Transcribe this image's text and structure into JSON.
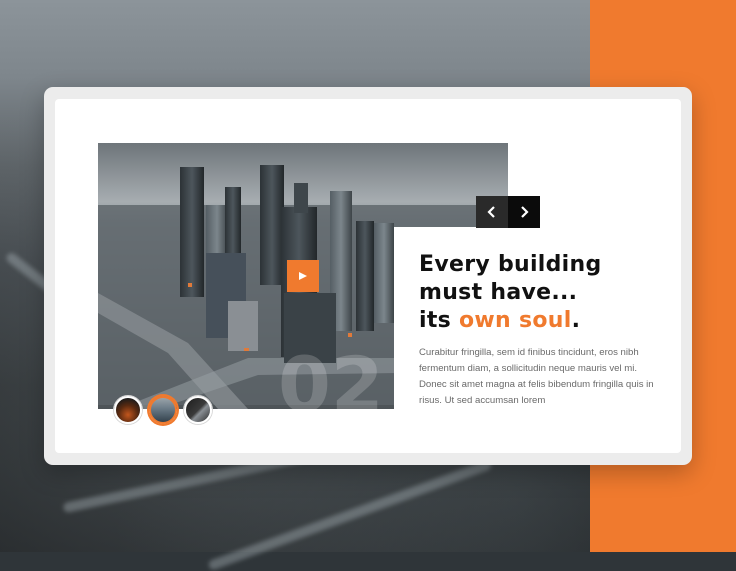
{
  "slider": {
    "heading_line1": "Every building",
    "heading_line2": "must have...",
    "heading_line3_prefix": "its ",
    "heading_line3_accent": "own soul",
    "heading_line3_suffix": ".",
    "body": "Curabitur fringilla, sem id finibus tincidunt, eros nibh fermentum diam, a sollicitudin neque mauris vel mi. Donec sit amet magna at felis bibendum fringilla quis in risus. Ut sed accumsan lorem",
    "slide_number_watermark": "02",
    "thumbnails": [
      {
        "name": "thumb-1",
        "active": false
      },
      {
        "name": "thumb-2",
        "active": true
      },
      {
        "name": "thumb-3",
        "active": false
      }
    ]
  },
  "icons": {
    "prev": "chevron-left-icon",
    "next": "chevron-right-icon",
    "play": "play-icon"
  },
  "colors": {
    "accent": "#f07a2e",
    "dark_button": "#0b0b0b",
    "text": "#111111",
    "body_text": "#6a6a6a"
  }
}
